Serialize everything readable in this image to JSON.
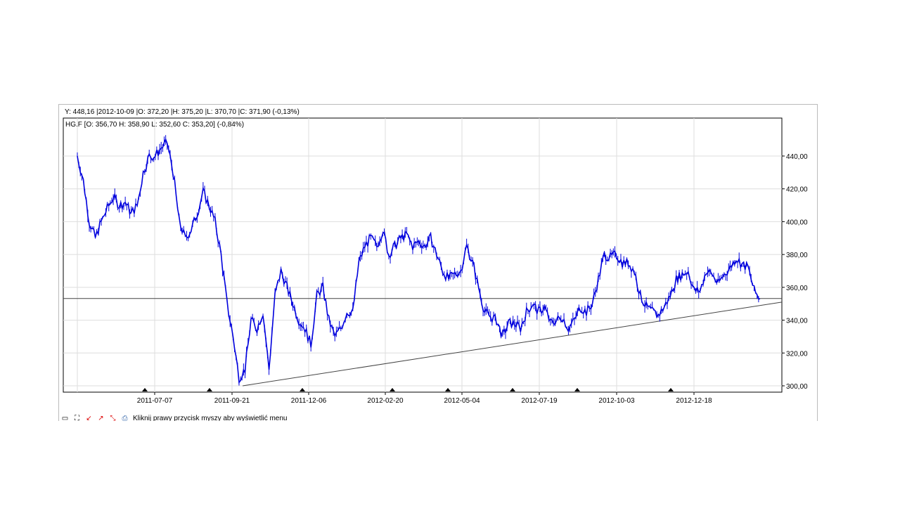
{
  "info_line": "Y: 448,16 |2012-10-09 |O: 372,20 |H: 375,20 |L: 370,70 |C: 371,90 (-0,13%)",
  "toolbar": {
    "hint": "Kliknij prawy przycisk myszy aby wyświetlić menu",
    "icons": [
      "frame-icon",
      "fit-icon",
      "arrow-down-icon",
      "arrow-up-icon",
      "zoom-arrows-icon",
      "print-icon"
    ]
  },
  "chart_data": {
    "type": "line",
    "title": "HG.F [O: 356,70  H: 358,90  L: 352,60  C: 353,20] (-0,84%)",
    "x_tick_labels": [
      "2011-07-07",
      "2011-09-21",
      "2011-12-06",
      "2012-02-20",
      "2012-05-04",
      "2012-07-19",
      "2012-10-03",
      "2012-12-18"
    ],
    "y_tick_labels": [
      "300,00",
      "320,00",
      "340,00",
      "360,00",
      "380,00",
      "400,00",
      "420,00",
      "440,00"
    ],
    "y_ticks": [
      300,
      320,
      340,
      360,
      380,
      400,
      420,
      440
    ],
    "ylim": [
      296,
      462
    ],
    "grid": true,
    "color": "#0000dd",
    "close_values": [
      440,
      425,
      400,
      390,
      400,
      408,
      415,
      410,
      412,
      405,
      410,
      430,
      440,
      440,
      445,
      448,
      430,
      400,
      390,
      395,
      405,
      418,
      410,
      400,
      380,
      350,
      330,
      305,
      310,
      340,
      335,
      345,
      310,
      355,
      370,
      360,
      350,
      340,
      335,
      325,
      355,
      360,
      340,
      330,
      335,
      345,
      345,
      375,
      385,
      390,
      385,
      395,
      380,
      385,
      390,
      392,
      385,
      388,
      385,
      390,
      380,
      370,
      365,
      368,
      370,
      385,
      375,
      360,
      345,
      342,
      340,
      330,
      338,
      338,
      335,
      345,
      350,
      345,
      348,
      338,
      340,
      342,
      335,
      340,
      348,
      345,
      350,
      365,
      380,
      378,
      380,
      375,
      375,
      370,
      355,
      348,
      345,
      343,
      348,
      355,
      365,
      368,
      370,
      358,
      358,
      370,
      368,
      362,
      368,
      372,
      378,
      374,
      372,
      358,
      353
    ],
    "horizontal_line": 353.2,
    "trendline": {
      "start_value": 300,
      "end_value": 351
    },
    "markers_count": 8
  }
}
